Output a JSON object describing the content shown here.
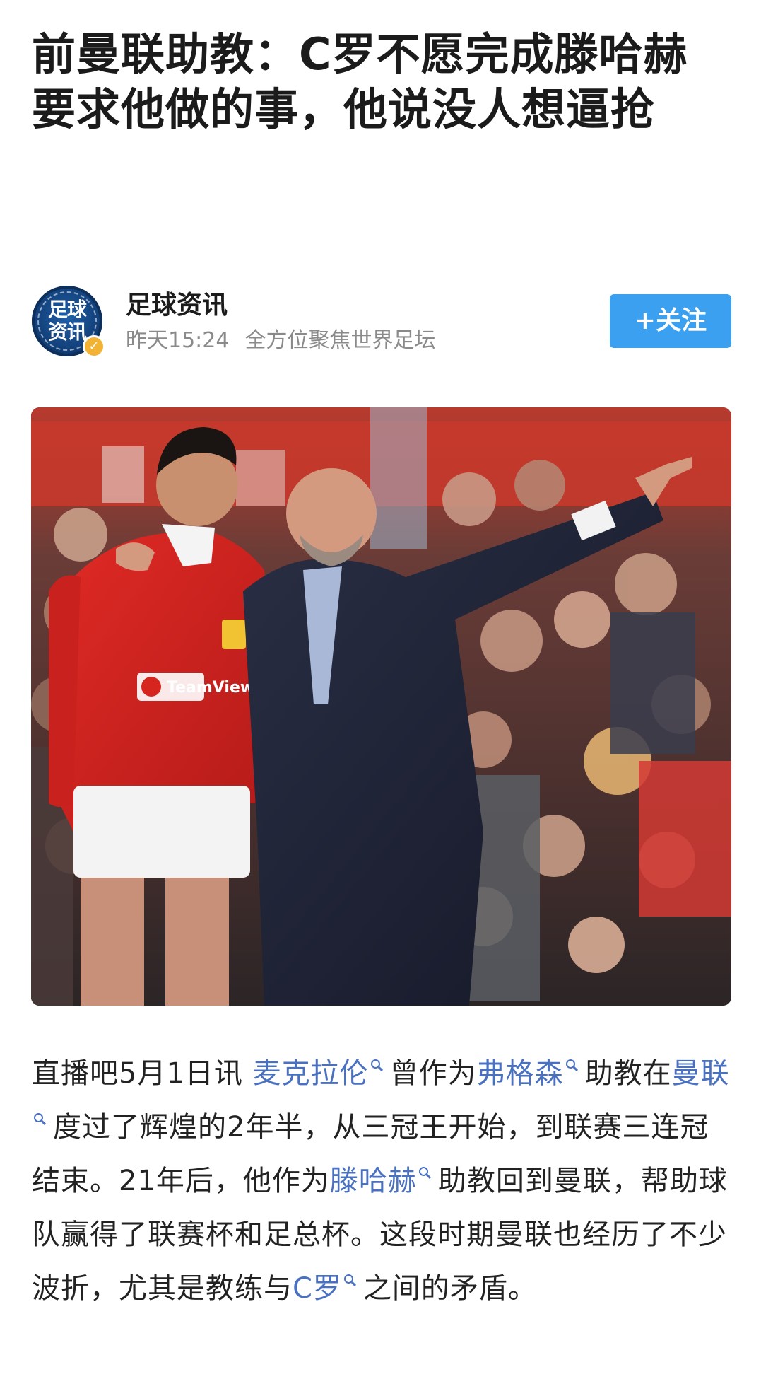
{
  "article": {
    "title": "前曼联助教：C罗不愿完成滕哈赫要求他做的事，他说没人想逼抢"
  },
  "author": {
    "avatar_text": "足球资讯",
    "avatar_icon": "football-logo-icon",
    "verified_icon": "verified-check-icon",
    "name": "足球资讯",
    "time": "昨天15:24",
    "bio": "全方位聚焦世界足坛",
    "follow_label": "+关注"
  },
  "photo": {
    "jersey_sponsor": "TeamViewer"
  },
  "body": {
    "p1_a": "直播吧5月1日讯 ",
    "tag1": "麦克拉伦",
    "p1_b": "曾作为",
    "tag2": "弗格森",
    "p1_c": "助教在",
    "tag3": "曼联",
    "p1_d": "度过了辉煌的2年半，从三冠王开始，到联赛三连冠结束。21年后，他作为",
    "tag4": "滕哈赫",
    "p1_e": "助教回到曼联，帮助球队赢得了联赛杯和足总杯。这段时期曼联也经历了不少波折，尤其是教练与",
    "tag5": "C罗",
    "p1_f": "之间的矛盾。"
  },
  "colors": {
    "link": "#4a70c0",
    "follow_button": "#3aa0ef",
    "verified_badge": "#f2b233",
    "meta_text": "#8a8a8a"
  }
}
